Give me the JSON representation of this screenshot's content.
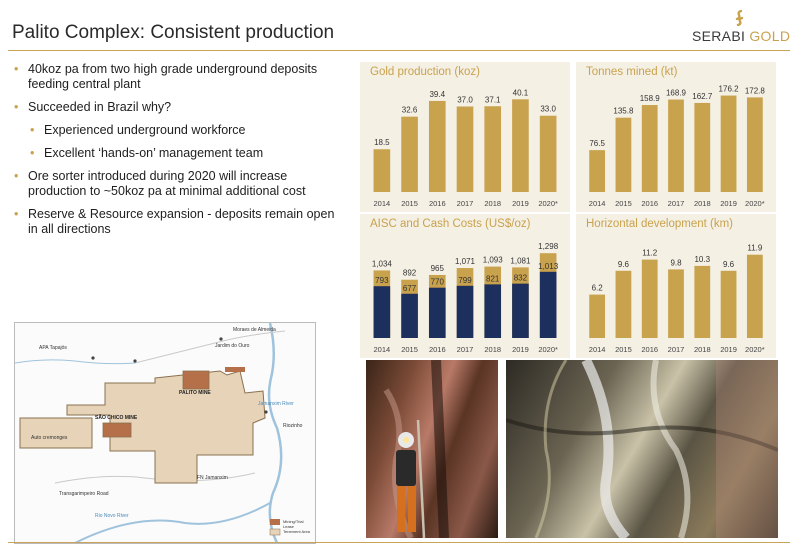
{
  "slide": {
    "title": "Palito Complex: Consistent production",
    "logo_primary": "SERABI",
    "logo_secondary": "GOLD"
  },
  "bullets": [
    {
      "text": "40koz pa from two high grade underground deposits feeding central plant",
      "level": 1
    },
    {
      "text": "Succeeded in Brazil why?",
      "level": 1
    },
    {
      "text": "Experienced underground workforce",
      "level": 2
    },
    {
      "text": "Excellent ‘hands-on’ management team",
      "level": 2
    },
    {
      "text": "Ore sorter introduced during 2020 will increase production to ~50koz pa at minimal additional cost",
      "level": 1
    },
    {
      "text": "Reserve & Resource expansion - deposits remain open in all directions",
      "level": 1
    }
  ],
  "map": {
    "labels": {
      "apa": "APA Tapajós",
      "jardim": "Jardim do Ouro",
      "moraes": "Moraes de Almeida",
      "palito": "PALITO MINE",
      "sao_chico": "SÃO CHICO MINE",
      "jamanxim_river": "Jamanxim River",
      "riozinho": "Riozinho",
      "cremonages": "Auto cremonges",
      "fn": "FN Jamanxim",
      "transgarimpeiro": "Transgarimpeiro Road",
      "rio_novo": "Rio Novo River"
    },
    "legend": [
      {
        "label": "Mining/Trial Lease",
        "color": "#b5704a"
      },
      {
        "label": "Tenement Area",
        "color": "#e6d3b8"
      }
    ]
  },
  "colors": {
    "gold": "#c9a24e",
    "navy": "#1d2f5c",
    "panel_bg": "#f4f0e4",
    "accent": "#c8a45a"
  },
  "chart_data": [
    {
      "type": "bar",
      "title": "Gold production (koz)",
      "categories": [
        "2014",
        "2015",
        "2016",
        "2017",
        "2018",
        "2019",
        "2020*"
      ],
      "values": [
        18.5,
        32.6,
        39.4,
        37.0,
        37.1,
        40.1,
        33.0
      ],
      "value_labels": [
        "18.5",
        "32.6",
        "39.4",
        "37.0",
        "37.1",
        "40.1",
        "33.0"
      ],
      "ylim": [
        0,
        45
      ]
    },
    {
      "type": "bar",
      "title": "Tonnes mined (kt)",
      "categories": [
        "2014",
        "2015",
        "2016",
        "2017",
        "2018",
        "2019",
        "2020*"
      ],
      "values": [
        76.5,
        135.8,
        158.9,
        168.9,
        162.7,
        176.2,
        172.8
      ],
      "value_labels": [
        "76.5",
        "135.8",
        "158.9",
        "168.9",
        "162.7",
        "176.2",
        "172.8"
      ],
      "ylim": [
        0,
        190
      ]
    },
    {
      "type": "bar",
      "title": "AISC and Cash Costs (US$/oz)",
      "categories": [
        "2014",
        "2015",
        "2016",
        "2017",
        "2018",
        "2019",
        "2020*"
      ],
      "series": [
        {
          "values": [
            793,
            677,
            770,
            799,
            821,
            832,
            1013
          ],
          "value_labels": [
            "793",
            "677",
            "770",
            "799",
            "821",
            "832",
            "1,013"
          ]
        },
        {
          "values": [
            1034,
            892,
            965,
            1071,
            1093,
            1081,
            1298
          ],
          "value_labels": [
            "1,034",
            "892",
            "965",
            "1,071",
            "1,093",
            "1,081",
            "1,298"
          ]
        }
      ],
      "ylim": [
        0,
        1500
      ]
    },
    {
      "type": "bar",
      "title": "Horizontal development (km)",
      "categories": [
        "2014",
        "2015",
        "2016",
        "2017",
        "2018",
        "2019",
        "2020*"
      ],
      "values": [
        6.2,
        9.6,
        11.2,
        9.8,
        10.3,
        9.6,
        11.9
      ],
      "value_labels": [
        "6.2",
        "9.6",
        "11.2",
        "9.8",
        "10.3",
        "9.6",
        "11.9"
      ],
      "ylim": [
        0,
        14
      ]
    }
  ]
}
